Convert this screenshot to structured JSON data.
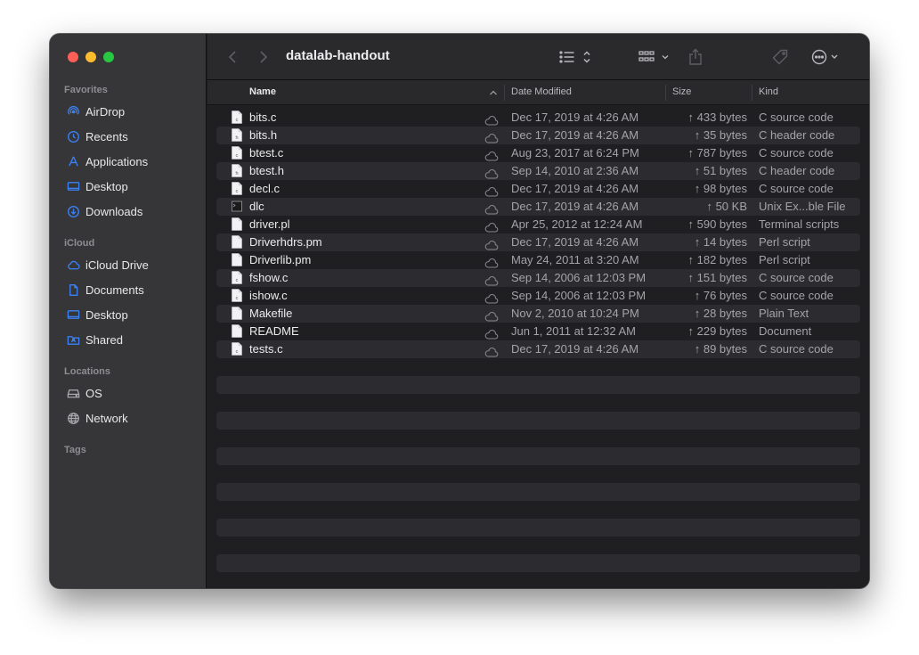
{
  "window": {
    "title": "datalab-handout"
  },
  "sidebar": {
    "favorites_head": "Favorites",
    "favorites": [
      {
        "label": "AirDrop",
        "icon": "airdrop-icon"
      },
      {
        "label": "Recents",
        "icon": "clock-icon"
      },
      {
        "label": "Applications",
        "icon": "applications-icon"
      },
      {
        "label": "Desktop",
        "icon": "desktop-icon"
      },
      {
        "label": "Downloads",
        "icon": "downloads-icon"
      }
    ],
    "icloud_head": "iCloud",
    "icloud": [
      {
        "label": "iCloud Drive",
        "icon": "cloud-icon"
      },
      {
        "label": "Documents",
        "icon": "document-icon"
      },
      {
        "label": "Desktop",
        "icon": "desktop-icon"
      },
      {
        "label": "Shared",
        "icon": "shared-folder-icon"
      }
    ],
    "locations_head": "Locations",
    "locations": [
      {
        "label": "OS",
        "icon": "disk-icon"
      },
      {
        "label": "Network",
        "icon": "globe-icon"
      }
    ],
    "tags_head": "Tags"
  },
  "columns": {
    "name": "Name",
    "date": "Date Modified",
    "size": "Size",
    "kind": "Kind"
  },
  "files": [
    {
      "name": "bits.c",
      "date": "Dec 17, 2019 at 4:26 AM",
      "size": "↑ 433 bytes",
      "kind": "C source code",
      "icon": "c-source-file-icon"
    },
    {
      "name": "bits.h",
      "date": "Dec 17, 2019 at 4:26 AM",
      "size": "↑ 35 bytes",
      "kind": "C header code",
      "icon": "c-header-file-icon"
    },
    {
      "name": "btest.c",
      "date": "Aug 23, 2017 at 6:24 PM",
      "size": "↑ 787 bytes",
      "kind": "C source code",
      "icon": "c-source-file-icon"
    },
    {
      "name": "btest.h",
      "date": "Sep 14, 2010 at 2:36 AM",
      "size": "↑ 51 bytes",
      "kind": "C header code",
      "icon": "c-header-file-icon"
    },
    {
      "name": "decl.c",
      "date": "Dec 17, 2019 at 4:26 AM",
      "size": "↑ 98 bytes",
      "kind": "C source code",
      "icon": "c-source-file-icon"
    },
    {
      "name": "dlc",
      "date": "Dec 17, 2019 at 4:26 AM",
      "size": "↑ 50 KB",
      "kind": "Unix Ex...ble File",
      "icon": "executable-icon"
    },
    {
      "name": "driver.pl",
      "date": "Apr 25, 2012 at 12:24 AM",
      "size": "↑ 590 bytes",
      "kind": "Terminal scripts",
      "icon": "document-file-icon"
    },
    {
      "name": "Driverhdrs.pm",
      "date": "Dec 17, 2019 at 4:26 AM",
      "size": "↑ 14 bytes",
      "kind": "Perl script",
      "icon": "document-file-icon"
    },
    {
      "name": "Driverlib.pm",
      "date": "May 24, 2011 at 3:20 AM",
      "size": "↑ 182 bytes",
      "kind": "Perl script",
      "icon": "document-file-icon"
    },
    {
      "name": "fshow.c",
      "date": "Sep 14, 2006 at 12:03 PM",
      "size": "↑ 151 bytes",
      "kind": "C source code",
      "icon": "c-source-file-icon"
    },
    {
      "name": "ishow.c",
      "date": "Sep 14, 2006 at 12:03 PM",
      "size": "↑ 76 bytes",
      "kind": "C source code",
      "icon": "c-source-file-icon"
    },
    {
      "name": "Makefile",
      "date": "Nov 2, 2010 at 10:24 PM",
      "size": "↑ 28 bytes",
      "kind": "Plain Text",
      "icon": "document-file-icon"
    },
    {
      "name": "README",
      "date": "Jun 1, 2011 at 12:32 AM",
      "size": "↑ 229 bytes",
      "kind": "Document",
      "icon": "document-file-icon"
    },
    {
      "name": "tests.c",
      "date": "Dec 17, 2019 at 4:26 AM",
      "size": "↑ 89 bytes",
      "kind": "C source code",
      "icon": "c-source-file-icon"
    }
  ],
  "colors": {
    "accent": "#3b82f6",
    "sidebar_bg": "#363538",
    "main_bg": "#1f1e21"
  }
}
